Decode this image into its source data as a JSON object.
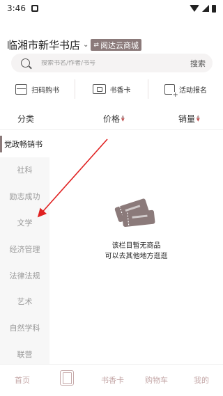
{
  "status_bar": {
    "time": "3:46"
  },
  "header": {
    "store_name": "临湘市新华书店",
    "cloud_store_label": "阅达云商城"
  },
  "search": {
    "placeholder": "搜索书名/作者/书号",
    "button_label": "搜索"
  },
  "quick_actions": [
    {
      "label": "扫码购书",
      "icon": "scan-icon"
    },
    {
      "label": "书香卡",
      "icon": "card-icon"
    },
    {
      "label": "活动报名",
      "icon": "activity-icon"
    }
  ],
  "sort_bar": {
    "category_label": "分类",
    "price_label": "价格",
    "sales_label": "销量"
  },
  "categories": [
    {
      "label": "党政畅销书",
      "active": true
    },
    {
      "label": "社科",
      "active": false
    },
    {
      "label": "励志成功",
      "active": false
    },
    {
      "label": "文学",
      "active": false
    },
    {
      "label": "经济管理",
      "active": false
    },
    {
      "label": "法律法规",
      "active": false
    },
    {
      "label": "艺术",
      "active": false
    },
    {
      "label": "自然学科",
      "active": false
    },
    {
      "label": "联营",
      "active": false
    }
  ],
  "empty_state": {
    "line1": "该栏目暂无商品",
    "line2": "可以去其他地方逛逛",
    "icon": "empty-tickets-icon"
  },
  "bottom_nav": {
    "home": "首页",
    "category_icon": "category-book-icon",
    "card": "书香卡",
    "cart": "购物车",
    "mine": "我的"
  },
  "colors": {
    "accent": "#8b7a7a",
    "nav_inactive": "#c4a7a7",
    "annotation": "#e02020"
  }
}
